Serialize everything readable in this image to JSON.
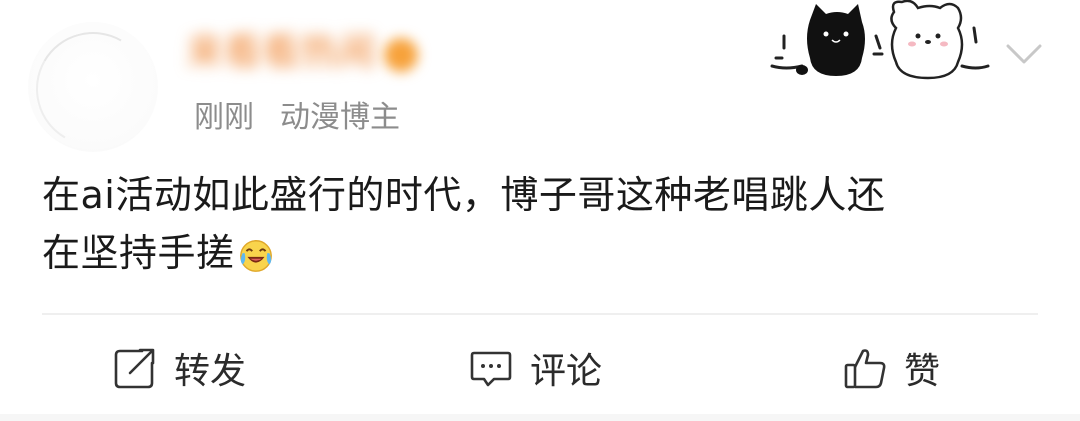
{
  "post": {
    "author": {
      "name": "来看看热闹",
      "time": "刚刚",
      "role": "动漫博主"
    },
    "content": {
      "line1": "在ai活动如此盛行的时代，博子哥这种老唱跳人还",
      "line2": "在坚持手搓",
      "emoji": "laugh-cry-emoji"
    }
  },
  "actions": {
    "repost": "转发",
    "comment": "评论",
    "like": "赞"
  },
  "icons": {
    "more": "chevron-down-icon",
    "repost": "repost-icon",
    "comment": "comment-icon",
    "like": "thumbs-up-icon"
  },
  "colors": {
    "text": "#1a1a1a",
    "meta": "#8c8c8c",
    "badge": "#f7a23b"
  }
}
